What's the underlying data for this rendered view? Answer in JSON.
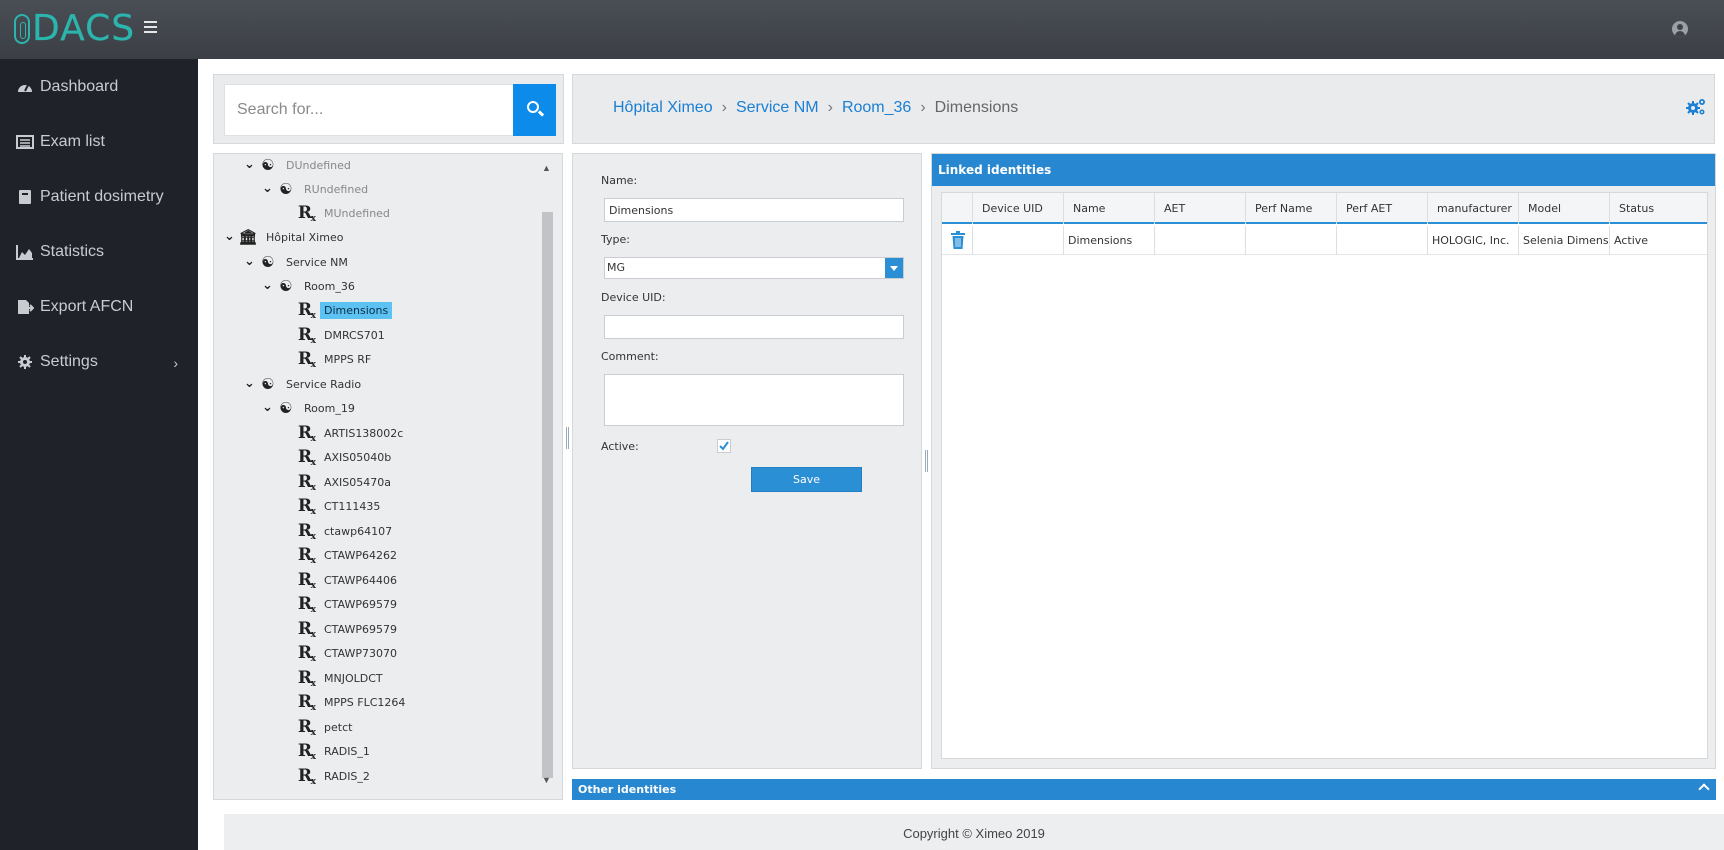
{
  "app": {
    "logo_text": "DACS"
  },
  "sidebar": {
    "items": [
      {
        "label": "Dashboard",
        "icon": "tachometer-icon"
      },
      {
        "label": "Exam list",
        "icon": "list-icon"
      },
      {
        "label": "Patient dosimetry",
        "icon": "book-icon"
      },
      {
        "label": "Statistics",
        "icon": "area-chart-icon"
      },
      {
        "label": "Export AFCN",
        "icon": "file-export-icon"
      },
      {
        "label": "Settings",
        "icon": "gear-icon",
        "has_submenu": true
      }
    ]
  },
  "search": {
    "placeholder": "Search for..."
  },
  "breadcrumb": {
    "items": [
      "Hôpital Ximeo",
      "Service NM",
      "Room_36"
    ],
    "current": "Dimensions"
  },
  "tree": {
    "nodes": [
      {
        "label": "DUndefined",
        "type": "service",
        "dim": true
      },
      {
        "label": "RUndefined",
        "type": "room",
        "dim": true
      },
      {
        "label": "MUndefined",
        "type": "device",
        "dim": true
      },
      {
        "label": "Hôpital Ximeo",
        "type": "hospital"
      },
      {
        "label": "Service NM",
        "type": "service"
      },
      {
        "label": "Room_36",
        "type": "room"
      },
      {
        "label": "Dimensions",
        "type": "device",
        "selected": true
      },
      {
        "label": "DMRCS701",
        "type": "device"
      },
      {
        "label": "MPPS RF",
        "type": "device"
      },
      {
        "label": "Service Radio",
        "type": "service"
      },
      {
        "label": "Room_19",
        "type": "room"
      },
      {
        "label": "ARTIS138002c",
        "type": "device"
      },
      {
        "label": "AXIS05040b",
        "type": "device"
      },
      {
        "label": "AXIS05470a",
        "type": "device"
      },
      {
        "label": "CT111435",
        "type": "device"
      },
      {
        "label": "ctawp64107",
        "type": "device"
      },
      {
        "label": "CTAWP64262",
        "type": "device"
      },
      {
        "label": "CTAWP64406",
        "type": "device"
      },
      {
        "label": "CTAWP69579",
        "type": "device"
      },
      {
        "label": "CTAWP69579",
        "type": "device"
      },
      {
        "label": "CTAWP73070",
        "type": "device"
      },
      {
        "label": "MNJOLDCT",
        "type": "device"
      },
      {
        "label": "MPPS FLC1264",
        "type": "device"
      },
      {
        "label": "petct",
        "type": "device"
      },
      {
        "label": "RADIS_1",
        "type": "device"
      },
      {
        "label": "RADIS_2",
        "type": "device"
      }
    ]
  },
  "form": {
    "name_label": "Name:",
    "name_value": "Dimensions",
    "type_label": "Type:",
    "type_value": "MG",
    "device_uid_label": "Device UID:",
    "device_uid_value": "",
    "comment_label": "Comment:",
    "comment_value": "",
    "active_label": "Active:",
    "active_checked": true,
    "save_label": "Save"
  },
  "linked": {
    "title": "Linked identities",
    "columns": [
      "",
      "Device UID",
      "Name",
      "AET",
      "Perf Name",
      "Perf AET",
      "manufacturer",
      "Model",
      "Status"
    ],
    "rows": [
      [
        "",
        "",
        "Dimensions",
        "",
        "",
        "",
        "HOLOGIC, Inc.",
        "Selenia Dimensions",
        "Active"
      ]
    ]
  },
  "other": {
    "title": "Other identities"
  },
  "footer": {
    "copyright": "Copyright © Ximeo 2019"
  },
  "colors": {
    "accent": "#2787d0",
    "brand": "#2bb5ad",
    "sidebar": "#1f2329",
    "selected": "#5cc2f2"
  }
}
